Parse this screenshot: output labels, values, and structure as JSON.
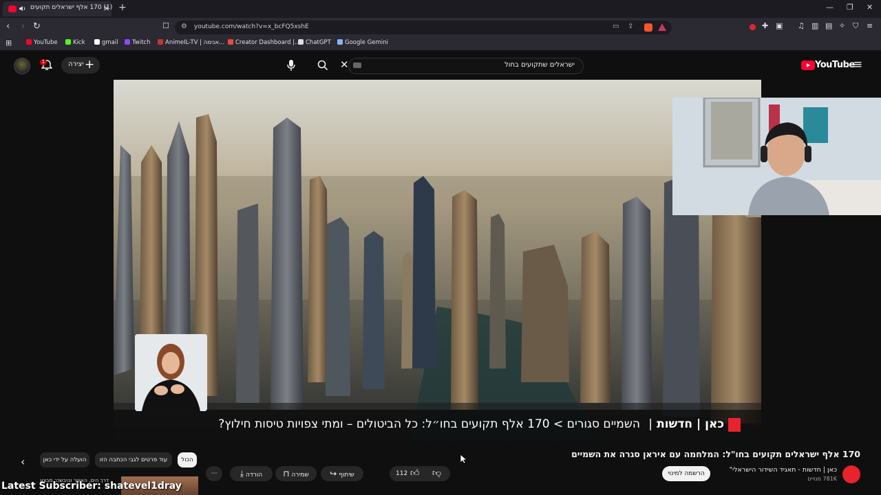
{
  "browser": {
    "tab_title": "(1) 170 אלף ישראלים תקועים",
    "url": "youtube.com/watch?v=x_bcFQ5xshE",
    "bookmarks": [
      {
        "label": "YouTube",
        "color": "#ff0033"
      },
      {
        "label": "Kick",
        "color": "#53fc18"
      },
      {
        "label": "gmail",
        "color": "#ffffff"
      },
      {
        "label": "Twitch",
        "color": "#9146ff"
      },
      {
        "label": "AnimeIL-TV | אנימה...",
        "color": "#c0392b"
      },
      {
        "label": "Creator Dashboard |...",
        "color": "#e74c3c"
      },
      {
        "label": "ChatGPT",
        "color": "#dddddd"
      },
      {
        "label": "Google Gemini",
        "color": "#8ab4f8"
      }
    ]
  },
  "youtube": {
    "logo_text": "YouTube",
    "search_query": "ישראלים שתקועים בחול",
    "create_label": "יצירה",
    "notification_count": "1"
  },
  "video": {
    "caption_brand": "כאן | חדשות",
    "caption_text": "השמיים סגורים  >  170 אלף תקועים בחו״ל: כל הביטולים – ומתי צפויות טיסות חילוץ?",
    "caption_separator": "|",
    "title": "170 אלף ישראלים תקועים בחו\"ל: המלחמה עם איראן סגרה את השמיים",
    "channel_name": "כאן | חדשות - תאגיד השידור הישראלי\"",
    "subscribers": "781K מנויים",
    "subscribe_label": "הרשמה למינוי",
    "likes": "112",
    "share_label": "שיתוף",
    "save_label": "שמירה",
    "download_label": "הורדה"
  },
  "chips": {
    "all": "הכול",
    "more": "עוד פרטים לגבי הכתבה הזו",
    "uploaded_by": "הועלה על ידי כאן"
  },
  "overlay": {
    "latest_subscriber": "Latest Subscriber: shatevel1dray",
    "reco_title": "דרך הים, האוויר והיבשה: מבצע"
  },
  "colors": {
    "brand_red": "#e8232d",
    "youtube_red": "#ff0033",
    "background": "#0f0f0f"
  }
}
